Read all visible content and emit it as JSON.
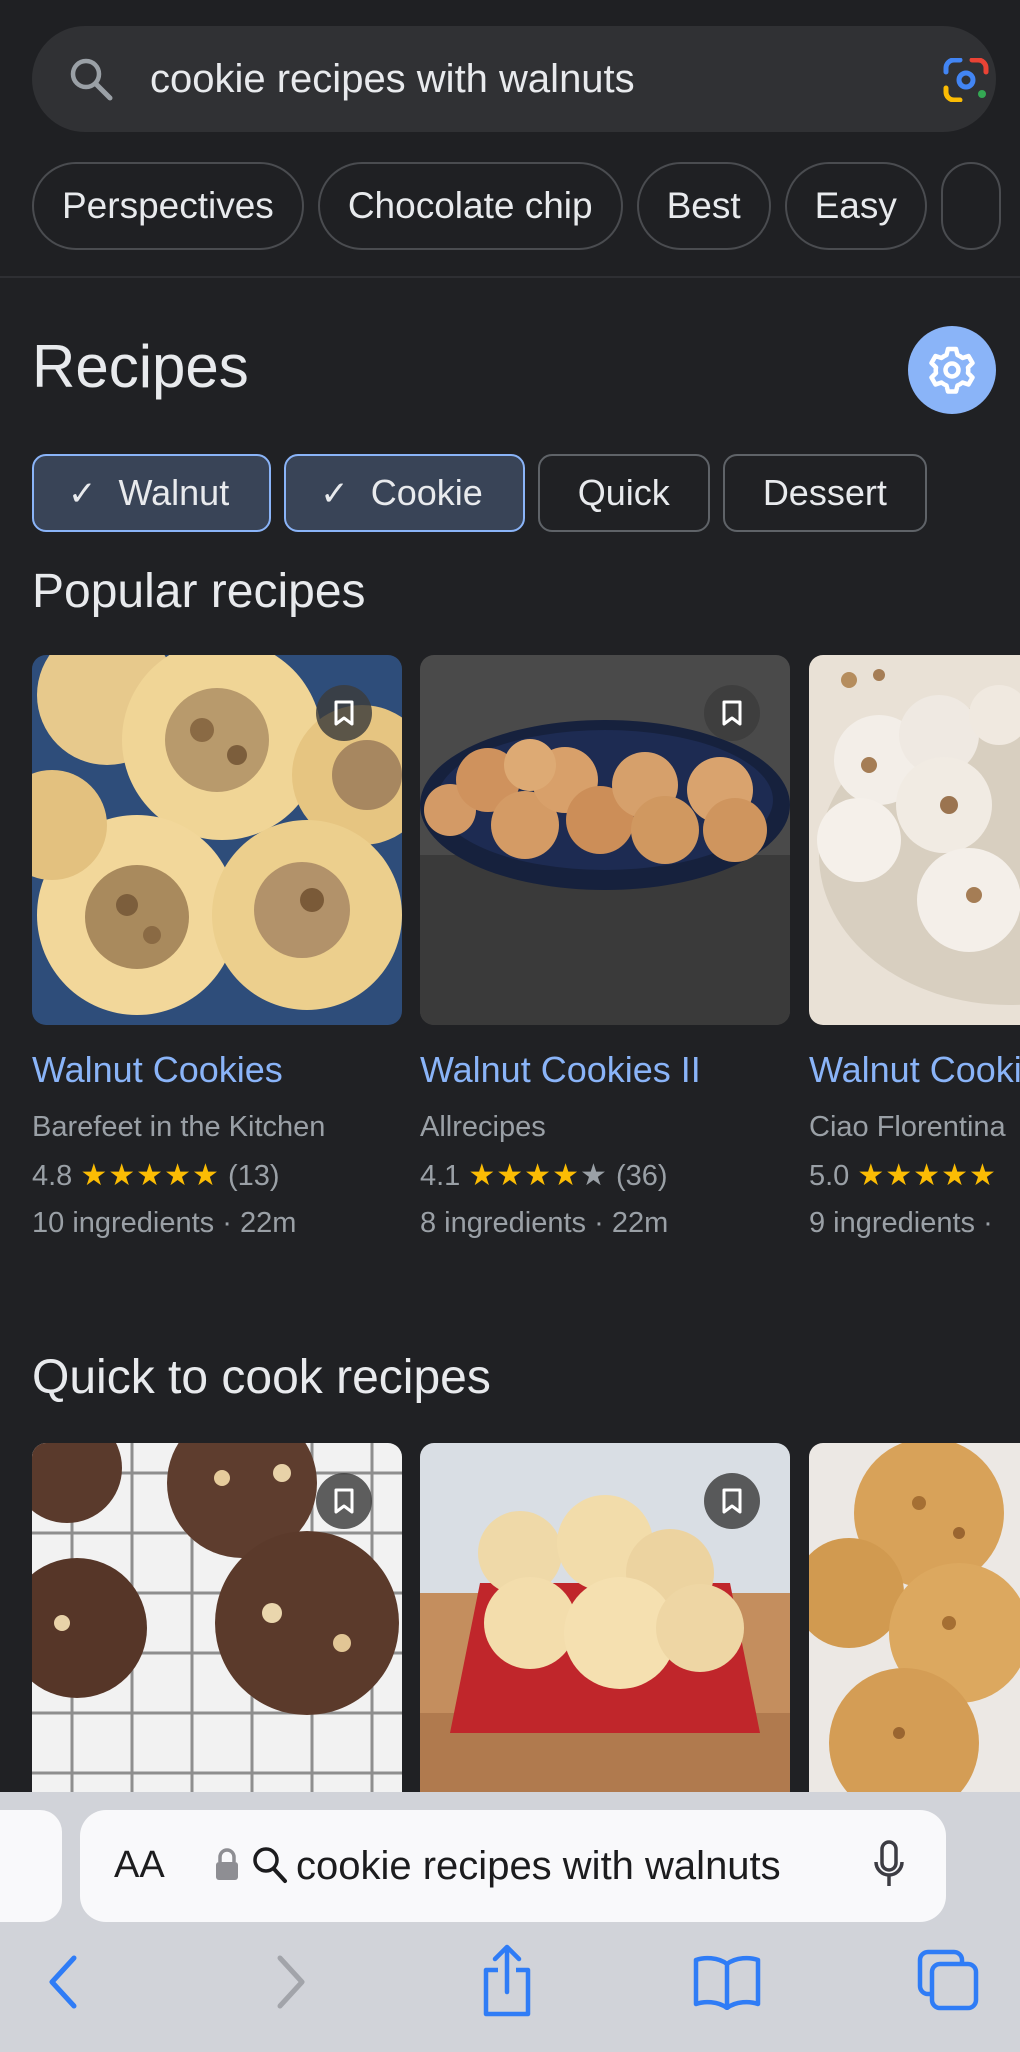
{
  "search": {
    "query": "cookie recipes with walnuts",
    "chips": [
      "Perspectives",
      "Chocolate chip",
      "Best",
      "Easy"
    ]
  },
  "recipes": {
    "title": "Recipes",
    "filters": [
      {
        "label": "Walnut",
        "selected": true
      },
      {
        "label": "Cookie",
        "selected": true
      },
      {
        "label": "Quick",
        "selected": false
      },
      {
        "label": "Dessert",
        "selected": false
      }
    ]
  },
  "popular": {
    "title": "Popular recipes",
    "cards": [
      {
        "title": "Walnut Cookies",
        "source": "Barefeet in the Kitchen",
        "rating": "4.8",
        "stars": "★★★★★",
        "reviews": "(13)",
        "meta": "10 ingredients · 22m"
      },
      {
        "title": "Walnut Cookies II",
        "source": "Allrecipes",
        "rating": "4.1",
        "stars": "★★★★",
        "stars_empty": "★",
        "reviews": "(36)",
        "meta": "8 ingredients · 22m"
      },
      {
        "title": "Walnut Cookies",
        "source": "Ciao Florentina",
        "rating": "5.0",
        "stars": "★★★★★",
        "reviews": "",
        "meta": "9 ingredients ·"
      }
    ]
  },
  "quick": {
    "title": "Quick to cook recipes"
  },
  "browser": {
    "aa_label": "AA",
    "url_text": "cookie recipes with walnuts"
  },
  "colors": {
    "background": "#202124",
    "accent_link": "#8ab4f8",
    "star": "#fbbc04"
  }
}
